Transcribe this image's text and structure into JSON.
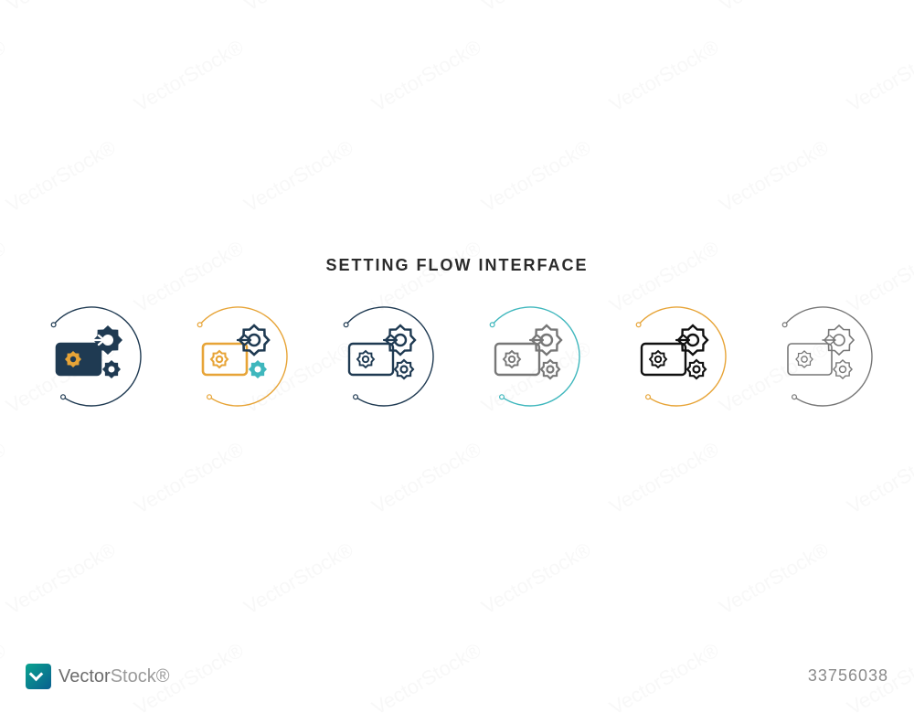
{
  "title": "SETTING FLOW INTERFACE",
  "watermark_text": "VectorStock®",
  "footer": {
    "brand_prefix": "Vector",
    "brand_suffix": "Stock®",
    "id_label": "33756038"
  },
  "palette": {
    "navy": "#1f3a52",
    "orange": "#e7a437",
    "teal": "#3fb7bd",
    "gray": "#777777",
    "black": "#111111"
  },
  "icons": [
    {
      "name": "filled-navy-orange",
      "ring": "#1f3a52",
      "rect": "#1f3a52",
      "rect_fill": "#1f3a52",
      "gear_big": "#1f3a52",
      "gear_small": "#1f3a52",
      "gear_inner": "#e7a437",
      "inner_fill": "#e7a437",
      "style": "filled"
    },
    {
      "name": "flat-orange-teal",
      "ring": "#e7a437",
      "rect": "#e7a437",
      "rect_fill": "none",
      "gear_big": "#1f3a52",
      "gear_small": "#3fb7bd",
      "gear_inner": "#e7a437",
      "inner_fill": "none",
      "style": "duotone"
    },
    {
      "name": "outline-navy",
      "ring": "#1f3a52",
      "rect": "#1f3a52",
      "rect_fill": "none",
      "gear_big": "#1f3a52",
      "gear_small": "#1f3a52",
      "gear_inner": "#1f3a52",
      "inner_fill": "none",
      "style": "outline"
    },
    {
      "name": "outline-teal",
      "ring": "#3fb7bd",
      "rect": "#777777",
      "rect_fill": "none",
      "gear_big": "#777777",
      "gear_small": "#777777",
      "gear_inner": "#777777",
      "inner_fill": "none",
      "style": "outline"
    },
    {
      "name": "outline-orange",
      "ring": "#e7a437",
      "rect": "#111111",
      "rect_fill": "none",
      "gear_big": "#111111",
      "gear_small": "#111111",
      "gear_inner": "#111111",
      "inner_fill": "none",
      "style": "outline"
    },
    {
      "name": "outline-gray",
      "ring": "#777777",
      "rect": "#777777",
      "rect_fill": "none",
      "gear_big": "#777777",
      "gear_small": "#777777",
      "gear_inner": "#777777",
      "inner_fill": "none",
      "style": "thin"
    }
  ]
}
